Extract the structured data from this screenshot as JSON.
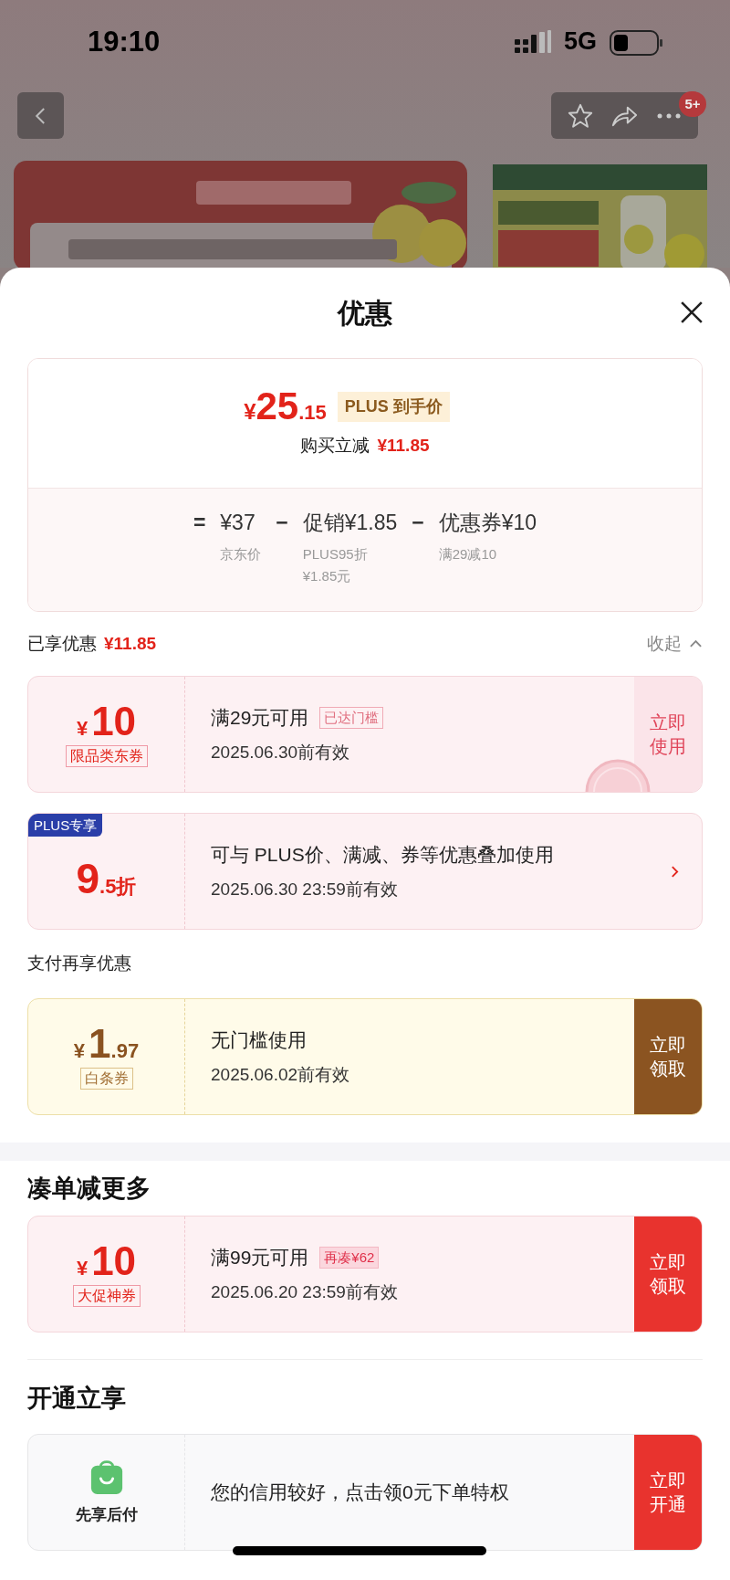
{
  "status_bar": {
    "time": "19:10",
    "network": "5G"
  },
  "nav": {
    "badge": "5+"
  },
  "sheet": {
    "title": "优惠",
    "price": {
      "currency": "¥",
      "integer": "25",
      "decimal": ".15",
      "badge": "PLUS 到手价",
      "saving_label": "购买立减",
      "saving_value": "¥11.85",
      "breakdown": [
        {
          "operator": "=",
          "value": "¥37",
          "notes": [
            "京东价"
          ]
        },
        {
          "operator": "−",
          "value": "促销¥1.85",
          "notes": [
            "PLUS95折",
            "¥1.85元"
          ]
        },
        {
          "operator": "−",
          "value": "优惠券¥10",
          "notes": [
            "满29减10"
          ]
        }
      ]
    },
    "sections": [
      {
        "kind": "summary",
        "label": "已享优惠",
        "value": "¥11.85",
        "toggle": "收起",
        "expanded": true,
        "coupons": [
          {
            "kind": "amount",
            "currency": "¥",
            "integer": "10",
            "label": "限品类东券",
            "condition": "满29元可用",
            "tag": "已达门槛",
            "validity": "2025.06.30前有效",
            "claimed": true,
            "action": {
              "label": "立即使用"
            }
          },
          {
            "kind": "discount",
            "badge": "PLUS专享",
            "integer": "9",
            "decimal": ".5折",
            "condition": "可与 PLUS价、满减、券等优惠叠加使用",
            "validity": "2025.06.30 23:59前有效"
          }
        ]
      },
      {
        "kind": "small",
        "title": "支付再享优惠",
        "coupons": [
          {
            "kind": "amount",
            "currency": "¥",
            "integer": "1",
            "decimal": ".97",
            "label": "白条券",
            "condition": "无门槛使用",
            "validity": "2025.06.02前有效",
            "action": {
              "label": "立即领取"
            }
          }
        ]
      },
      {
        "kind": "large",
        "title": "凑单减更多",
        "coupons": [
          {
            "kind": "amount",
            "currency": "¥",
            "integer": "10",
            "label": "大促神券",
            "condition": "满99元可用",
            "tag": "再凑¥62",
            "claimed": false,
            "validity": "2025.06.20 23:59前有效",
            "action": {
              "label": "立即领取"
            }
          }
        ]
      },
      {
        "kind": "large",
        "title": "开通立享",
        "coupons": [
          {
            "kind": "service",
            "label": "先享后付",
            "condition": "您的信用较好，点击领0元下单特权",
            "action": {
              "label": "立即开通"
            }
          }
        ]
      }
    ]
  }
}
